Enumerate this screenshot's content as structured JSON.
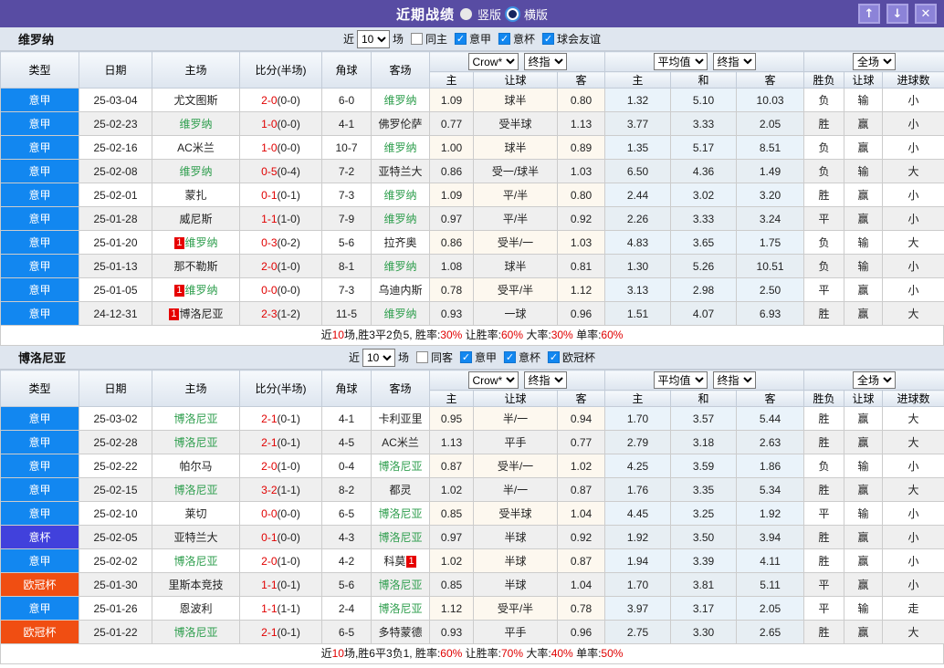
{
  "title_bar": {
    "title": "近期战绩",
    "layout_options": [
      {
        "label": "竖版",
        "selected": false
      },
      {
        "label": "横版",
        "selected": true
      }
    ],
    "buttons": [
      {
        "name": "move-up",
        "glyph": "↑"
      },
      {
        "name": "move-down",
        "glyph": "↓"
      },
      {
        "name": "close",
        "glyph": "✕"
      }
    ]
  },
  "columns": {
    "main": [
      "类型",
      "日期",
      "主场",
      "比分(半场)",
      "角球",
      "客场"
    ],
    "group1_selects": [
      "Crow*",
      "终指"
    ],
    "group2_selects": [
      "平均值",
      "终指"
    ],
    "group3_selects": [
      "全场"
    ],
    "sub": [
      "主",
      "让球",
      "客",
      "主",
      "和",
      "客",
      "胜负",
      "让球",
      "进球数"
    ]
  },
  "league_colors": {
    "意甲": "#1287f0",
    "意杯": "#4141dc",
    "欧冠杯": "#f04e12"
  },
  "result_colors": {
    "r": "#e00000",
    "b": "#2222cc",
    "g": "#1f9e45"
  },
  "tables": [
    {
      "team": "维罗纳",
      "filters": {
        "prefix": "近",
        "count": "10",
        "suffix": "场",
        "checks": [
          {
            "label": "同主",
            "checked": false
          },
          {
            "label": "意甲",
            "checked": true
          },
          {
            "label": "意杯",
            "checked": true
          },
          {
            "label": "球会友谊",
            "checked": true
          }
        ]
      },
      "rows": [
        {
          "type": "意甲",
          "date": "25-03-04",
          "home": "尤文图斯",
          "home_green": false,
          "home_badge": "",
          "score": "2-0",
          "half": "0-0",
          "corner": "6-0",
          "away": "维罗纳",
          "away_green": true,
          "away_badge": "",
          "odds": [
            "1.09",
            "球半",
            "0.80"
          ],
          "avg": [
            "1.32",
            "5.10",
            "10.03"
          ],
          "res": [
            "负",
            "输",
            "小"
          ],
          "res_c": [
            "b",
            "b",
            "b"
          ]
        },
        {
          "type": "意甲",
          "date": "25-02-23",
          "home": "维罗纳",
          "home_green": true,
          "home_badge": "",
          "score": "1-0",
          "half": "0-0",
          "corner": "4-1",
          "away": "佛罗伦萨",
          "away_green": false,
          "away_badge": "",
          "odds": [
            "0.77",
            "受半球",
            "1.13"
          ],
          "avg": [
            "3.77",
            "3.33",
            "2.05"
          ],
          "res": [
            "胜",
            "赢",
            "小"
          ],
          "res_c": [
            "r",
            "r",
            "b"
          ]
        },
        {
          "type": "意甲",
          "date": "25-02-16",
          "home": "AC米兰",
          "home_green": false,
          "home_badge": "",
          "score": "1-0",
          "half": "0-0",
          "corner": "10-7",
          "away": "维罗纳",
          "away_green": true,
          "away_badge": "",
          "odds": [
            "1.00",
            "球半",
            "0.89"
          ],
          "avg": [
            "1.35",
            "5.17",
            "8.51"
          ],
          "res": [
            "负",
            "赢",
            "小"
          ],
          "res_c": [
            "b",
            "r",
            "b"
          ]
        },
        {
          "type": "意甲",
          "date": "25-02-08",
          "home": "维罗纳",
          "home_green": true,
          "home_badge": "",
          "score": "0-5",
          "half": "0-4",
          "corner": "7-2",
          "away": "亚特兰大",
          "away_green": false,
          "away_badge": "",
          "odds": [
            "0.86",
            "受一/球半",
            "1.03"
          ],
          "avg": [
            "6.50",
            "4.36",
            "1.49"
          ],
          "res": [
            "负",
            "输",
            "大"
          ],
          "res_c": [
            "b",
            "b",
            "r"
          ]
        },
        {
          "type": "意甲",
          "date": "25-02-01",
          "home": "蒙扎",
          "home_green": false,
          "home_badge": "",
          "score": "0-1",
          "half": "0-1",
          "corner": "7-3",
          "away": "维罗纳",
          "away_green": true,
          "away_badge": "",
          "odds": [
            "1.09",
            "平/半",
            "0.80"
          ],
          "avg": [
            "2.44",
            "3.02",
            "3.20"
          ],
          "res": [
            "胜",
            "赢",
            "小"
          ],
          "res_c": [
            "r",
            "r",
            "b"
          ]
        },
        {
          "type": "意甲",
          "date": "25-01-28",
          "home": "威尼斯",
          "home_green": false,
          "home_badge": "",
          "score": "1-1",
          "half": "1-0",
          "corner": "7-9",
          "away": "维罗纳",
          "away_green": true,
          "away_badge": "",
          "odds": [
            "0.97",
            "平/半",
            "0.92"
          ],
          "avg": [
            "2.26",
            "3.33",
            "3.24"
          ],
          "res": [
            "平",
            "赢",
            "小"
          ],
          "res_c": [
            "g",
            "r",
            "b"
          ]
        },
        {
          "type": "意甲",
          "date": "25-01-20",
          "home": "维罗纳",
          "home_green": true,
          "home_badge": "1",
          "score": "0-3",
          "half": "0-2",
          "corner": "5-6",
          "away": "拉齐奥",
          "away_green": false,
          "away_badge": "",
          "odds": [
            "0.86",
            "受半/一",
            "1.03"
          ],
          "avg": [
            "4.83",
            "3.65",
            "1.75"
          ],
          "res": [
            "负",
            "输",
            "大"
          ],
          "res_c": [
            "b",
            "b",
            "r"
          ]
        },
        {
          "type": "意甲",
          "date": "25-01-13",
          "home": "那不勒斯",
          "home_green": false,
          "home_badge": "",
          "score": "2-0",
          "half": "1-0",
          "corner": "8-1",
          "away": "维罗纳",
          "away_green": true,
          "away_badge": "",
          "odds": [
            "1.08",
            "球半",
            "0.81"
          ],
          "avg": [
            "1.30",
            "5.26",
            "10.51"
          ],
          "res": [
            "负",
            "输",
            "小"
          ],
          "res_c": [
            "b",
            "b",
            "b"
          ]
        },
        {
          "type": "意甲",
          "date": "25-01-05",
          "home": "维罗纳",
          "home_green": true,
          "home_badge": "1",
          "score": "0-0",
          "half": "0-0",
          "corner": "7-3",
          "away": "乌迪内斯",
          "away_green": false,
          "away_badge": "",
          "odds": [
            "0.78",
            "受平/半",
            "1.12"
          ],
          "avg": [
            "3.13",
            "2.98",
            "2.50"
          ],
          "res": [
            "平",
            "赢",
            "小"
          ],
          "res_c": [
            "g",
            "r",
            "b"
          ]
        },
        {
          "type": "意甲",
          "date": "24-12-31",
          "home": "博洛尼亚",
          "home_green": false,
          "home_badge": "1",
          "score": "2-3",
          "half": "1-2",
          "corner": "11-5",
          "away": "维罗纳",
          "away_green": true,
          "away_badge": "",
          "odds": [
            "0.93",
            "一球",
            "0.96"
          ],
          "avg": [
            "1.51",
            "4.07",
            "6.93"
          ],
          "res": [
            "胜",
            "赢",
            "大"
          ],
          "res_c": [
            "r",
            "r",
            "r"
          ]
        }
      ],
      "summary": [
        {
          "t": "近"
        },
        {
          "t": "10",
          "red": true
        },
        {
          "t": "场,胜3平2负5, 胜率:"
        },
        {
          "t": "30%",
          "red": true
        },
        {
          "t": " 让胜率:"
        },
        {
          "t": "60%",
          "red": true
        },
        {
          "t": " 大率:"
        },
        {
          "t": "30%",
          "red": true
        },
        {
          "t": " 单率:"
        },
        {
          "t": "60%",
          "red": true
        }
      ]
    },
    {
      "team": "博洛尼亚",
      "filters": {
        "prefix": "近",
        "count": "10",
        "suffix": "场",
        "checks": [
          {
            "label": "同客",
            "checked": false
          },
          {
            "label": "意甲",
            "checked": true
          },
          {
            "label": "意杯",
            "checked": true
          },
          {
            "label": "欧冠杯",
            "checked": true
          }
        ]
      },
      "rows": [
        {
          "type": "意甲",
          "date": "25-03-02",
          "home": "博洛尼亚",
          "home_green": true,
          "home_badge": "",
          "score": "2-1",
          "half": "0-1",
          "corner": "4-1",
          "away": "卡利亚里",
          "away_green": false,
          "away_badge": "",
          "odds": [
            "0.95",
            "半/一",
            "0.94"
          ],
          "avg": [
            "1.70",
            "3.57",
            "5.44"
          ],
          "res": [
            "胜",
            "赢",
            "大"
          ],
          "res_c": [
            "r",
            "r",
            "r"
          ]
        },
        {
          "type": "意甲",
          "date": "25-02-28",
          "home": "博洛尼亚",
          "home_green": true,
          "home_badge": "",
          "score": "2-1",
          "half": "0-1",
          "corner": "4-5",
          "away": "AC米兰",
          "away_green": false,
          "away_badge": "",
          "odds": [
            "1.13",
            "平手",
            "0.77"
          ],
          "avg": [
            "2.79",
            "3.18",
            "2.63"
          ],
          "res": [
            "胜",
            "赢",
            "大"
          ],
          "res_c": [
            "r",
            "r",
            "r"
          ]
        },
        {
          "type": "意甲",
          "date": "25-02-22",
          "home": "帕尔马",
          "home_green": false,
          "home_badge": "",
          "score": "2-0",
          "half": "1-0",
          "corner": "0-4",
          "away": "博洛尼亚",
          "away_green": true,
          "away_badge": "",
          "odds": [
            "0.87",
            "受半/一",
            "1.02"
          ],
          "avg": [
            "4.25",
            "3.59",
            "1.86"
          ],
          "res": [
            "负",
            "输",
            "小"
          ],
          "res_c": [
            "b",
            "b",
            "b"
          ]
        },
        {
          "type": "意甲",
          "date": "25-02-15",
          "home": "博洛尼亚",
          "home_green": true,
          "home_badge": "",
          "score": "3-2",
          "half": "1-1",
          "corner": "8-2",
          "away": "都灵",
          "away_green": false,
          "away_badge": "",
          "odds": [
            "1.02",
            "半/一",
            "0.87"
          ],
          "avg": [
            "1.76",
            "3.35",
            "5.34"
          ],
          "res": [
            "胜",
            "赢",
            "大"
          ],
          "res_c": [
            "r",
            "r",
            "r"
          ]
        },
        {
          "type": "意甲",
          "date": "25-02-10",
          "home": "莱切",
          "home_green": false,
          "home_badge": "",
          "score": "0-0",
          "half": "0-0",
          "corner": "6-5",
          "away": "博洛尼亚",
          "away_green": true,
          "away_badge": "",
          "odds": [
            "0.85",
            "受半球",
            "1.04"
          ],
          "avg": [
            "4.45",
            "3.25",
            "1.92"
          ],
          "res": [
            "平",
            "输",
            "小"
          ],
          "res_c": [
            "g",
            "b",
            "b"
          ]
        },
        {
          "type": "意杯",
          "date": "25-02-05",
          "home": "亚特兰大",
          "home_green": false,
          "home_badge": "",
          "score": "0-1",
          "half": "0-0",
          "corner": "4-3",
          "away": "博洛尼亚",
          "away_green": true,
          "away_badge": "",
          "odds": [
            "0.97",
            "半球",
            "0.92"
          ],
          "avg": [
            "1.92",
            "3.50",
            "3.94"
          ],
          "res": [
            "胜",
            "赢",
            "小"
          ],
          "res_c": [
            "r",
            "r",
            "b"
          ]
        },
        {
          "type": "意甲",
          "date": "25-02-02",
          "home": "博洛尼亚",
          "home_green": true,
          "home_badge": "",
          "score": "2-0",
          "half": "1-0",
          "corner": "4-2",
          "away": "科莫",
          "away_green": false,
          "away_badge": "1",
          "odds": [
            "1.02",
            "半球",
            "0.87"
          ],
          "avg": [
            "1.94",
            "3.39",
            "4.11"
          ],
          "res": [
            "胜",
            "赢",
            "小"
          ],
          "res_c": [
            "r",
            "r",
            "b"
          ]
        },
        {
          "type": "欧冠杯",
          "date": "25-01-30",
          "home": "里斯本竞技",
          "home_green": false,
          "home_badge": "",
          "score": "1-1",
          "half": "0-1",
          "corner": "5-6",
          "away": "博洛尼亚",
          "away_green": true,
          "away_badge": "",
          "odds": [
            "0.85",
            "半球",
            "1.04"
          ],
          "avg": [
            "1.70",
            "3.81",
            "5.11"
          ],
          "res": [
            "平",
            "赢",
            "小"
          ],
          "res_c": [
            "g",
            "r",
            "b"
          ]
        },
        {
          "type": "意甲",
          "date": "25-01-26",
          "home": "恩波利",
          "home_green": false,
          "home_badge": "",
          "score": "1-1",
          "half": "1-1",
          "corner": "2-4",
          "away": "博洛尼亚",
          "away_green": true,
          "away_badge": "",
          "odds": [
            "1.12",
            "受平/半",
            "0.78"
          ],
          "avg": [
            "3.97",
            "3.17",
            "2.05"
          ],
          "res": [
            "平",
            "输",
            "走"
          ],
          "res_c": [
            "g",
            "b",
            "g"
          ]
        },
        {
          "type": "欧冠杯",
          "date": "25-01-22",
          "home": "博洛尼亚",
          "home_green": true,
          "home_badge": "",
          "score": "2-1",
          "half": "0-1",
          "corner": "6-5",
          "away": "多特蒙德",
          "away_green": false,
          "away_badge": "",
          "odds": [
            "0.93",
            "平手",
            "0.96"
          ],
          "avg": [
            "2.75",
            "3.30",
            "2.65"
          ],
          "res": [
            "胜",
            "赢",
            "大"
          ],
          "res_c": [
            "r",
            "r",
            "r"
          ]
        }
      ],
      "summary": [
        {
          "t": "近"
        },
        {
          "t": "10",
          "red": true
        },
        {
          "t": "场,胜6平3负1, 胜率:"
        },
        {
          "t": "60%",
          "red": true
        },
        {
          "t": " 让胜率:"
        },
        {
          "t": "70%",
          "red": true
        },
        {
          "t": " 大率:"
        },
        {
          "t": "40%",
          "red": true
        },
        {
          "t": " 单率:"
        },
        {
          "t": "50%",
          "red": true
        }
      ]
    }
  ]
}
